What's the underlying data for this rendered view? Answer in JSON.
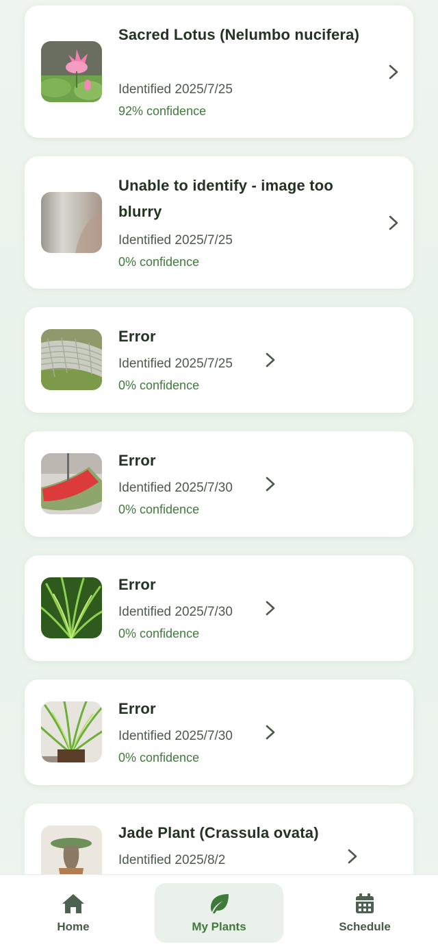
{
  "plants": [
    {
      "name": "Sacred Lotus (Nelumbo nucifera)",
      "date": "Identified 2025/7/25",
      "confidence": "92% confidence",
      "thumb_icon": "lotus-photo"
    },
    {
      "name": "Unable to identify - image too blurry",
      "date": "Identified 2025/7/25",
      "confidence": "0% confidence",
      "thumb_icon": "blurry-photo"
    },
    {
      "name": "Error",
      "date": "Identified 2025/7/25",
      "confidence": "0% confidence",
      "thumb_icon": "mesh-photo"
    },
    {
      "name": "Error",
      "date": "Identified 2025/7/30",
      "confidence": "0% confidence",
      "thumb_icon": "watermelon-photo"
    },
    {
      "name": "Error",
      "date": "Identified 2025/7/30",
      "confidence": "0% confidence",
      "thumb_icon": "grass-photo"
    },
    {
      "name": "Error",
      "date": "Identified 2025/7/30",
      "confidence": "0% confidence",
      "thumb_icon": "grass-pot-photo"
    },
    {
      "name": "Jade Plant (Crassula ovata)",
      "date": "Identified 2025/8/2",
      "confidence": "",
      "thumb_icon": "jade-photo"
    }
  ],
  "nav": {
    "home": {
      "label": "Home",
      "icon": "house-icon"
    },
    "my_plants": {
      "label": "My Plants",
      "icon": "leaf-icon"
    },
    "schedule": {
      "label": "Schedule",
      "icon": "calendar-icon"
    }
  },
  "colors": {
    "accent": "#3f7a3b",
    "background": "#eef5ee",
    "card": "#ffffff",
    "title": "#223322"
  }
}
